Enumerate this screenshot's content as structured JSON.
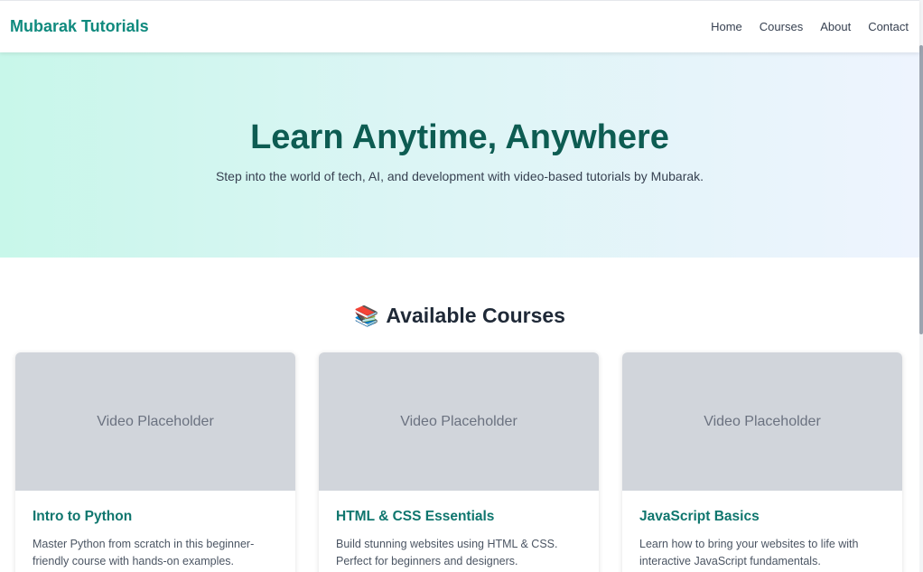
{
  "header": {
    "brand": "Mubarak Tutorials",
    "nav": [
      "Home",
      "Courses",
      "About",
      "Contact"
    ]
  },
  "hero": {
    "title": "Learn Anytime, Anywhere",
    "subtitle": "Step into the world of tech, AI, and development with video-based tutorials by Mubarak."
  },
  "courses": {
    "heading_icon": "📚",
    "heading": "Available Courses",
    "items": [
      {
        "video_label": "Video Placeholder",
        "title": "Intro to Python",
        "description": "Master Python from scratch in this beginner-friendly course with hands-on examples."
      },
      {
        "video_label": "Video Placeholder",
        "title": "HTML & CSS Essentials",
        "description": "Build stunning websites using HTML & CSS. Perfect for beginners and designers."
      },
      {
        "video_label": "Video Placeholder",
        "title": "JavaScript Basics",
        "description": "Learn how to bring your websites to life with interactive JavaScript fundamentals."
      }
    ]
  },
  "colors": {
    "brand": "#0f8a7e",
    "hero_title": "#0d5c52",
    "card_title": "#0f766e",
    "placeholder_bg": "#d1d5db"
  }
}
